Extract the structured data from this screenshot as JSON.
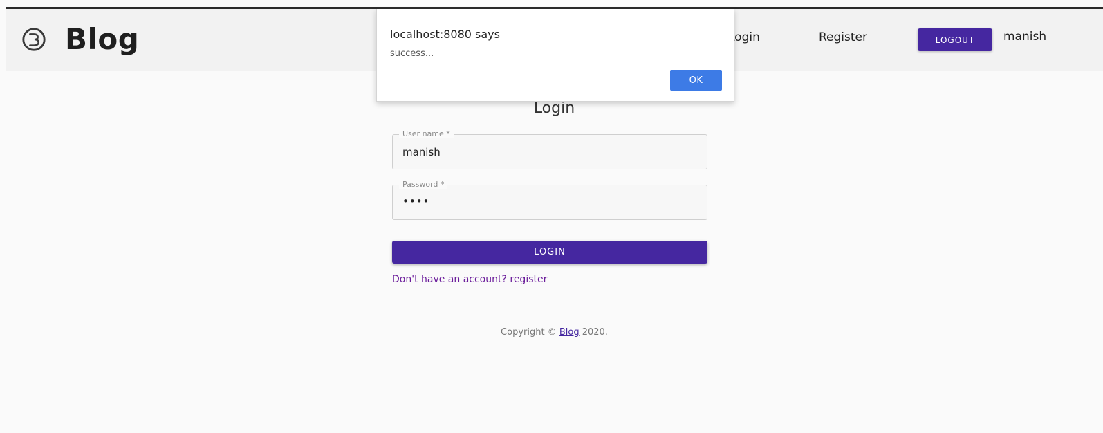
{
  "header": {
    "brand_name": "Blog",
    "nav_login": "Login",
    "nav_register": "Register",
    "logout_label": "LOGOUT",
    "username": "manish"
  },
  "alert": {
    "title": "localhost:8080 says",
    "message": "success...",
    "ok_label": "OK"
  },
  "login_form": {
    "title": "Login",
    "username_label": "User name *",
    "username_value": "manish",
    "password_label": "Password *",
    "password_value": "••••",
    "submit_label": "LOGIN",
    "register_link": "Don't have an account? register"
  },
  "footer": {
    "copyright_prefix": "Copyright © ",
    "copyright_link": "Blog",
    "copyright_suffix": " 2020."
  },
  "colors": {
    "primary": "#4527a0",
    "alert_button": "#3d7be6",
    "link": "#6a1b9a"
  },
  "icons": {
    "brand": "blog-logo-icon"
  }
}
